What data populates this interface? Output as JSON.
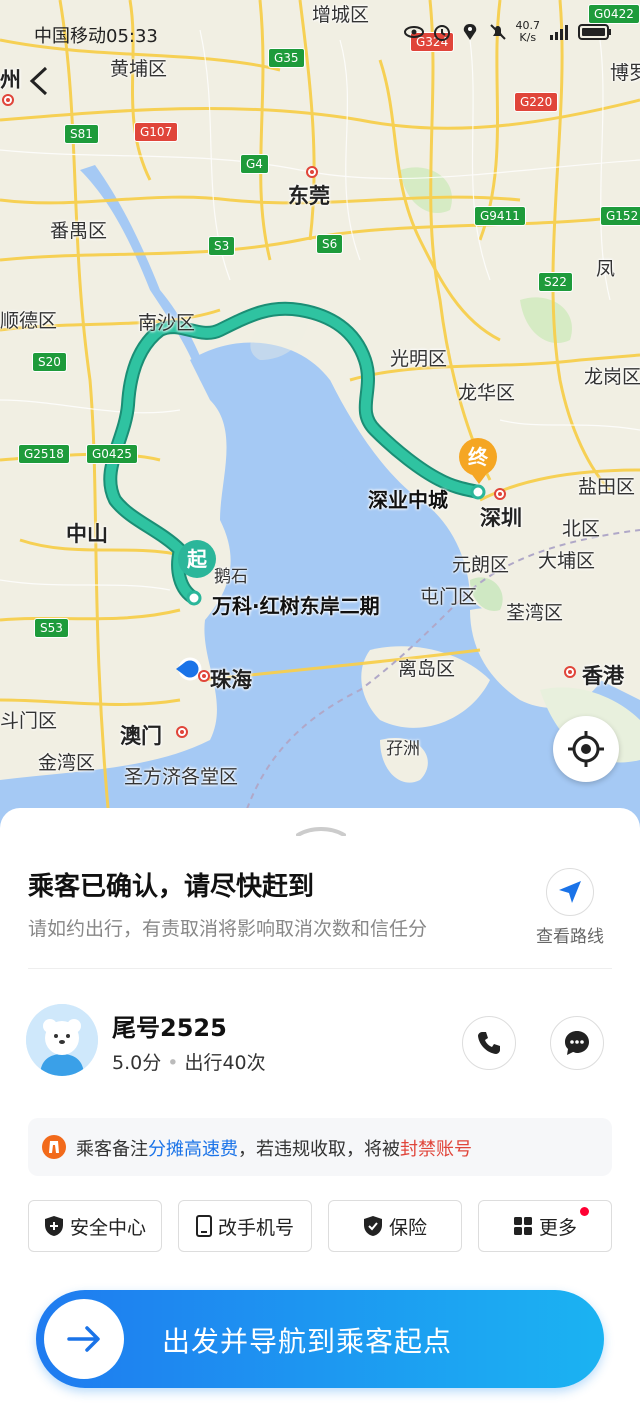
{
  "status_bar": {
    "carrier_time": "中国移动05:33",
    "net_speed_value": "40.7",
    "net_speed_unit": "K/s"
  },
  "map": {
    "districts": [
      "增城区",
      "黄埔区",
      "州",
      "东莞",
      "番禺区",
      "顺德区",
      "南沙区",
      "光明区",
      "龙华区",
      "龙岗区",
      "中山",
      "盐田区",
      "深圳",
      "北区",
      "大埔区",
      "元朗区",
      "屯门区",
      "荃湾区",
      "离岛区",
      "香港",
      "珠海",
      "澳门",
      "斗门区",
      "金湾区",
      "圣方济各堂区",
      "孖洲",
      "博罗",
      "凤",
      "鹅石"
    ],
    "road_shields": [
      "G0422",
      "G35",
      "G324",
      "G107",
      "S81",
      "G220",
      "G4",
      "G9411",
      "G152",
      "S3",
      "S6",
      "S22",
      "S20",
      "G2518",
      "G0425",
      "S53"
    ],
    "start_marker": "起",
    "end_marker": "终",
    "start_place": "万科·红树东岸二期",
    "end_place": "深业中城"
  },
  "panel": {
    "title": "乘客已确认，请尽快赶到",
    "subtitle": "请如约出行，有责取消将影响取消次数和信任分",
    "view_route_label": "查看路线",
    "passenger": {
      "name": "尾号2525",
      "rating": "5.0分",
      "trips": "出行40次"
    },
    "notice": {
      "prefix": "乘客备注",
      "highlight": "分摊高速费",
      "middle": "，若违规收取，将被",
      "warning": "封禁账号"
    },
    "actions": [
      {
        "label": "安全中心",
        "icon": "shield-plus-icon"
      },
      {
        "label": "改手机号",
        "icon": "phone-icon"
      },
      {
        "label": "保险",
        "icon": "shield-check-icon"
      },
      {
        "label": "更多",
        "icon": "grid-icon"
      }
    ],
    "go_button": "出发并导航到乘客起点"
  },
  "colors": {
    "route": "#2bb69a",
    "accent": "#1a73e8",
    "warning": "#e0453a",
    "start": "#2bb69a",
    "end": "#f5a623"
  }
}
